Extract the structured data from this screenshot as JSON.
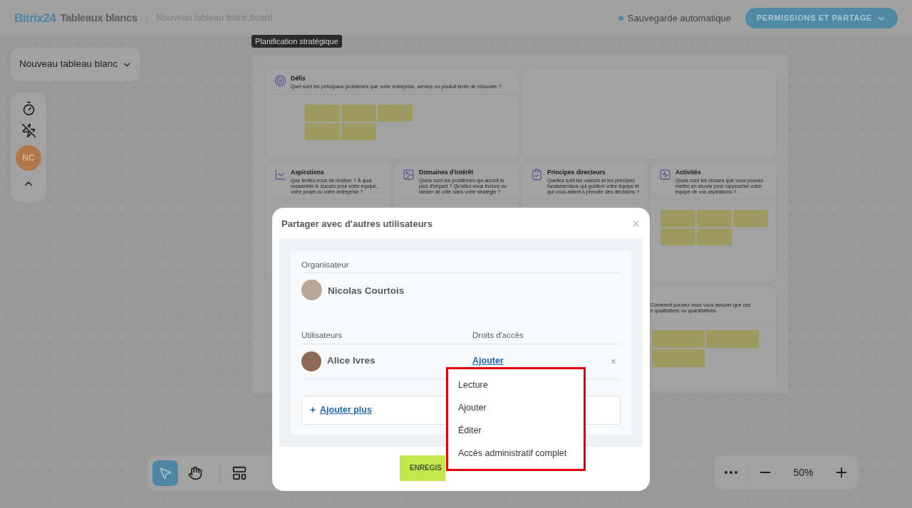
{
  "header": {
    "brand": "Bitrix24",
    "app_name": "Tableaux blancs",
    "file_name": "Nouveau tableau blanc.board",
    "autosave": "Sauvegarde automatique",
    "permissions_button": "PERMISSIONS ET PARTAGE"
  },
  "board_selector": {
    "label": "Nouveau tableau blanc"
  },
  "side_tools": {
    "avatar_initials": "NC"
  },
  "board": {
    "label": "Planification stratégique",
    "cards": [
      {
        "title": "Défis",
        "description": "Quel sont les principaux problèmes que votre entreprise, service ou produit tente de résoudre ?",
        "notes": [
          {
            "color": "#9c9a5e"
          },
          {
            "color": "#9c9a5e"
          },
          {
            "color": "#9c9a5e"
          },
          {
            "color": "#9c9a5e"
          },
          {
            "color": "#9c9a5e"
          }
        ]
      },
      {
        "title": "Aspirations",
        "description": "Que tentez-vous de réaliser ? À quoi ressemble le succès pour votre équipe, votre projet ou votre entreprise ?"
      },
      {
        "title": "Domaines d'intérêt",
        "description": "Quels sont les problèmes qui auront le plus d'impact ? Qu'allez-vous inclure ou laisser de côté dans votre stratégie ?"
      },
      {
        "title": "Principes directeurs",
        "description": "Quelles sont les valeurs et les principes fondamentaux qui guident votre équipe et qui vous aident à prendre des décisions ?"
      },
      {
        "title": "Activités",
        "description": "Quels sont les choses que vous pouvez mettre en œuvre pour rapprocher votre équipe de vos aspirations ?",
        "notes": [
          {
            "color": "#9c9a5e"
          },
          {
            "color": "#9c9a5e"
          },
          {
            "color": "#9c9a5e"
          },
          {
            "color": "#9c9a5e"
          },
          {
            "color": "#9c9a5e"
          }
        ]
      }
    ],
    "partial_card": {
      "lines": [
        "Comment pouvez-vous vous assurer que ces",
        "e qualitatives ou quantitatives."
      ],
      "notes": [
        {
          "color": "#9c9a5e"
        },
        {
          "color": "#9c9a5e"
        },
        {
          "color": "#9c9a5e"
        }
      ]
    }
  },
  "toolbar": {
    "tools": [
      {
        "kind": "pointer",
        "selected": true
      },
      {
        "kind": "hand",
        "selected": false
      }
    ]
  },
  "zoom": {
    "value": "50%"
  },
  "share_dialog": {
    "title": "Partager avec d'autres utilisateurs",
    "organizer_label": "Organisateur",
    "organizer": {
      "name": "Nicolas Courtois"
    },
    "users_header": "Utilisateurs",
    "rights_header": "Droits d'accès",
    "users": [
      {
        "name": "Alice Ivres",
        "right": "Ajouter"
      }
    ],
    "add_more": "Ajouter plus",
    "save_button": "ENREGIS"
  },
  "rights_menu": {
    "options": [
      {
        "label": "Lecture",
        "selected": false
      },
      {
        "label": "Ajouter",
        "selected": false
      },
      {
        "label": "Éditer",
        "selected": false
      },
      {
        "label": "Accès administratif complet",
        "selected": false
      }
    ]
  }
}
